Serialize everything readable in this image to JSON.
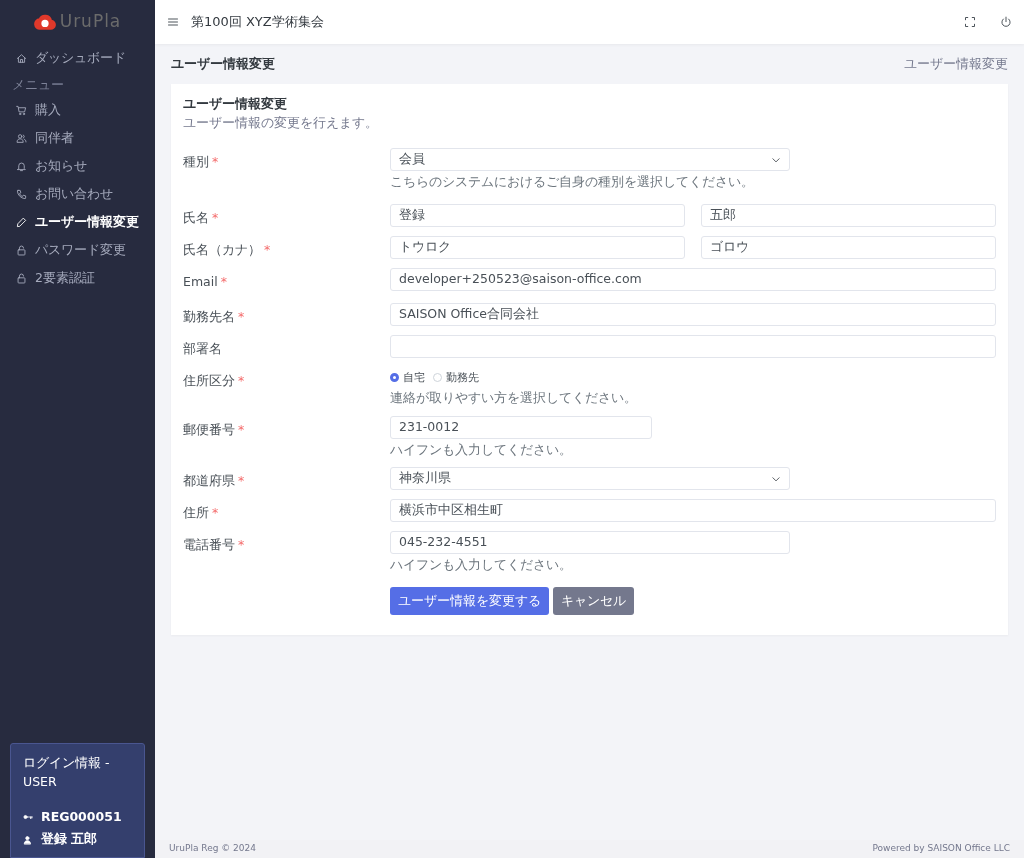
{
  "brand": {
    "name": "UruPla"
  },
  "sidebar": {
    "items": [
      {
        "kind": "link",
        "label": "ダッシュボード",
        "selected": false
      },
      {
        "kind": "heading",
        "label": "メニュー"
      },
      {
        "kind": "link",
        "label": "購入",
        "selected": false
      },
      {
        "kind": "link",
        "label": "同伴者",
        "selected": false
      },
      {
        "kind": "link",
        "label": "お知らせ",
        "selected": false
      },
      {
        "kind": "link",
        "label": "お問い合わせ",
        "selected": false
      },
      {
        "kind": "link",
        "label": "ユーザー情報変更",
        "selected": true
      },
      {
        "kind": "link",
        "label": "パスワード変更",
        "selected": false
      },
      {
        "kind": "link",
        "label": "2要素認証",
        "selected": false
      }
    ],
    "login_box": {
      "title": "ログイン情報 - USER",
      "user_id": "REG000051",
      "user_name": "登録 五郎"
    }
  },
  "header": {
    "title": "第100回 XYZ学術集会"
  },
  "page": {
    "title": "ユーザー情報変更",
    "breadcrumb": "ユーザー情報変更"
  },
  "card": {
    "title": "ユーザー情報変更",
    "subtitle": "ユーザー情報の変更を行えます。",
    "sections": [
      {
        "fields": [
          {
            "kind": "select",
            "label": "種別",
            "required_mark": "*",
            "value": "会員",
            "help": "こちらのシステムにおけるご自身の種別を選択してください。"
          }
        ]
      },
      {
        "fields": [
          {
            "kind": "name_pair",
            "label": "氏名",
            "required_mark": "*",
            "values": [
              "登録",
              "五郎"
            ]
          },
          {
            "kind": "name_pair",
            "label": "氏名（カナ）",
            "required_mark": "*",
            "values": [
              "トウロク",
              "ゴロウ"
            ]
          },
          {
            "kind": "text",
            "label": "Email",
            "required_mark": "*",
            "value": "developer+250523@saison-office.com"
          }
        ]
      },
      {
        "fields": [
          {
            "kind": "text",
            "label": "勤務先名",
            "required_mark": "*",
            "value": "SAISON Office合同会社"
          },
          {
            "kind": "text",
            "label": "部署名"
          },
          {
            "kind": "radio",
            "label": "住所区分",
            "required_mark": "*",
            "options": [
              {
                "label": "自宅",
                "selected": true
              },
              {
                "label": "勤務先",
                "selected": false
              }
            ],
            "help": "連絡が取りやすい方を選択してください。"
          },
          {
            "kind": "postal",
            "label": "郵便番号",
            "required_mark": "*",
            "value": "231-0012",
            "help": "ハイフンも入力してください。"
          },
          {
            "kind": "select",
            "label": "都道府県",
            "required_mark": "*",
            "value": "神奈川県"
          },
          {
            "kind": "text",
            "label": "住所",
            "required_mark": "*",
            "value": "横浜市中区相生町"
          },
          {
            "kind": "phone",
            "label": "電話番号",
            "required_mark": "*",
            "value": "045-232-4551",
            "help": "ハイフンも入力してください。"
          }
        ]
      }
    ],
    "buttons": [
      {
        "kind": "primary",
        "label": "ユーザー情報を変更する"
      },
      {
        "kind": "secondary",
        "label": "キャンセル"
      }
    ]
  },
  "footer": {
    "left": "UruPla Reg © 2024",
    "right": "Powered by SAISON Office LLC"
  }
}
